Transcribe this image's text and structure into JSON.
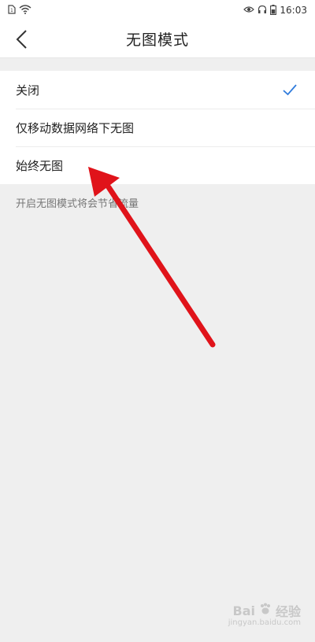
{
  "status_bar": {
    "time": "16:03",
    "icons": [
      "sim-icon",
      "wifi-icon",
      "eye-icon",
      "headphones-icon",
      "battery-icon"
    ]
  },
  "nav": {
    "title": "无图模式",
    "back_icon": "chevron-left-icon"
  },
  "options": [
    {
      "label": "关闭",
      "selected": true
    },
    {
      "label": "仅移动数据网络下无图",
      "selected": false
    },
    {
      "label": "始终无图",
      "selected": false
    }
  ],
  "hint": "开启无图模式将会节省流量",
  "colors": {
    "accent": "#2f7bdc",
    "annotation_arrow": "#e0131a"
  },
  "watermark": {
    "brand": "Bai",
    "brand_suffix": "经验",
    "sub": "jingyan.baidu.com"
  }
}
